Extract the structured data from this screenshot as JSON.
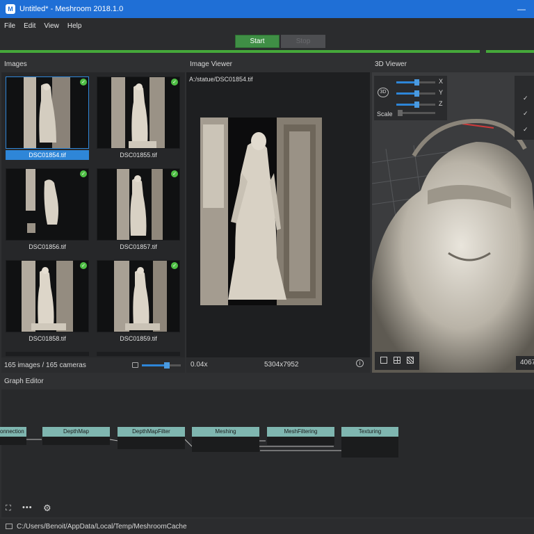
{
  "window": {
    "title": "Untitled* - Meshroom 2018.1.0",
    "app_icon": "meshroom-logo"
  },
  "menu": [
    "File",
    "Edit",
    "View",
    "Help"
  ],
  "toolbar": {
    "start_label": "Start",
    "stop_label": "Stop"
  },
  "images_panel": {
    "title": "Images",
    "items": [
      {
        "label": "DSC01854.tif",
        "selected": true
      },
      {
        "label": "DSC01855.tif",
        "selected": false
      },
      {
        "label": "DSC01856.tif",
        "selected": false
      },
      {
        "label": "DSC01857.tif",
        "selected": false
      },
      {
        "label": "DSC01858.tif",
        "selected": false
      },
      {
        "label": "DSC01859.tif",
        "selected": false
      }
    ],
    "footer": "165 images / 165 cameras",
    "thumb_size_fraction": 0.65
  },
  "image_viewer": {
    "title": "Image Viewer",
    "path": "A:/statue/DSC01854.tif",
    "zoom": "0.04x",
    "resolution": "5304x7952"
  },
  "viewer3d": {
    "title": "3D Viewer",
    "axes": [
      "X",
      "Y",
      "Z"
    ],
    "scale_label": "Scale",
    "mode_badge": "3D",
    "corner_value": "4067"
  },
  "graph_editor": {
    "title": "Graph Editor",
    "nodes": [
      {
        "name": "onnection"
      },
      {
        "name": "DepthMap"
      },
      {
        "name": "DepthMapFilter"
      },
      {
        "name": "Meshing"
      },
      {
        "name": "MeshFiltering"
      },
      {
        "name": "Texturing"
      }
    ]
  },
  "status": {
    "path": "C:/Users/Benoit/AppData/Local/Temp/MeshroomCache"
  },
  "colors": {
    "accent": "#1f6fd6",
    "start": "#3f8f45",
    "progress": "#45a83a",
    "selection": "#2e86d8",
    "node_header": "#7fb6b0"
  }
}
